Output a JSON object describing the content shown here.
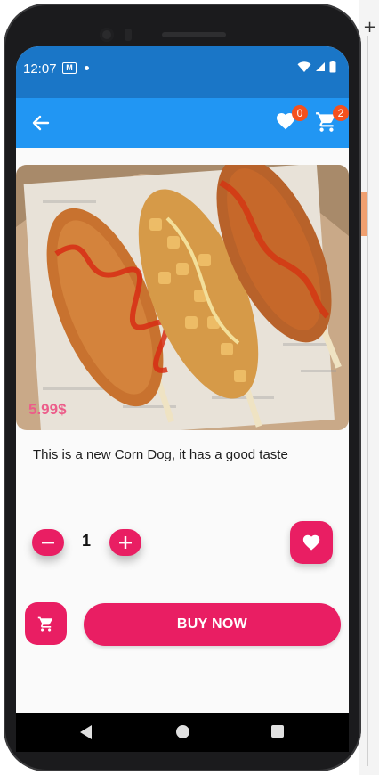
{
  "status_bar": {
    "time": "12:07"
  },
  "app_bar": {
    "favorites_count": "0",
    "cart_count": "2"
  },
  "product": {
    "price": "5.99$",
    "description": "This is a new Corn Dog, it has a good taste",
    "image_subject": "three corn dogs with ketchup in a box"
  },
  "quantity": {
    "value": "1"
  },
  "actions": {
    "buy_label": "BUY NOW"
  },
  "colors": {
    "status_bar": "#1a76c7",
    "app_bar": "#2196f3",
    "accent": "#e91e63",
    "price": "#ec5d8a",
    "badge": "#f4511e"
  },
  "icons": [
    "back-arrow-icon",
    "heart-icon",
    "cart-icon",
    "minus-icon",
    "plus-icon",
    "wifi-icon",
    "signal-icon",
    "battery-icon",
    "gmail-icon"
  ]
}
